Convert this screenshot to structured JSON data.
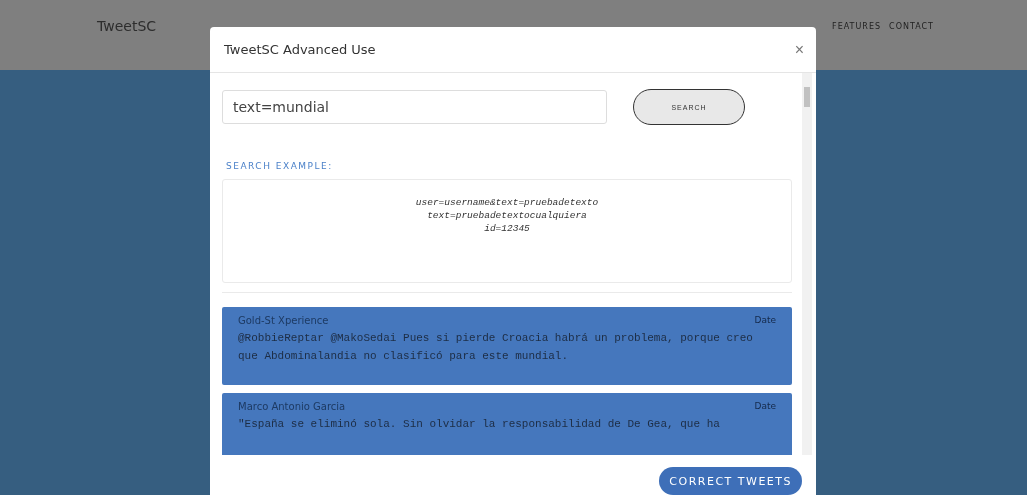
{
  "navbar": {
    "brand": "TweetSC",
    "links": [
      "FEATURES",
      "CONTACT"
    ]
  },
  "modal": {
    "title": "TweetSC Advanced Use",
    "close": "×",
    "search": {
      "value": "text=mundial",
      "button": "SEARCH"
    },
    "example": {
      "heading": "SEARCH EXAMPLE:",
      "lines": [
        "user=username&text=pruebadetexto",
        "text=pruebadetextocualquiera",
        "id=12345"
      ]
    },
    "tweets": [
      {
        "author": "Gold-St Xperience",
        "date": "Date",
        "text": "@RobbieReptar @MakoSedai Pues si pierde Croacia habrá un problema, porque creo que Abdominalandia no clasificó para este mundial."
      },
      {
        "author": "Marco Antonio Garcia",
        "date": "Date",
        "text": "\"España se eliminó sola. Sin olvidar la responsabilidad de De Gea, que ha"
      }
    ],
    "footer_button": "CORRECT TWEETS"
  }
}
